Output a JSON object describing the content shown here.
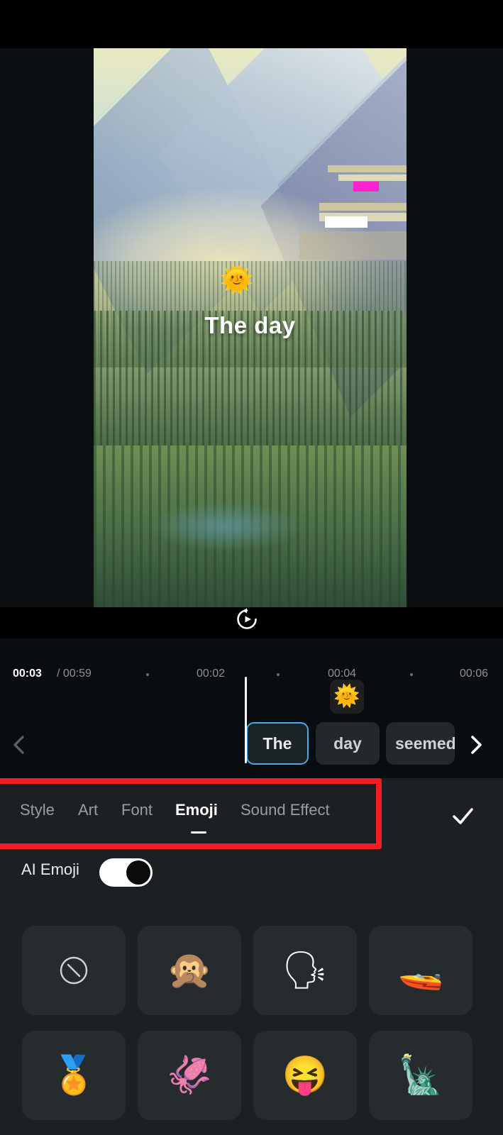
{
  "preview": {
    "caption_text": "The day",
    "sticker_emoji": "🌞",
    "replay_icon": "replay-icon"
  },
  "timeline": {
    "current_time": "00:03",
    "total_time_separator": "/ 00:59",
    "total_time": "00:59",
    "tick_labels": [
      "00:02",
      "00:04",
      "00:06"
    ],
    "sticker_chip_emoji": "🌞",
    "nav_prev_icon": "chevron-left-icon",
    "nav_next_icon": "chevron-right-icon",
    "words": [
      {
        "text": "The",
        "selected": true
      },
      {
        "text": "day",
        "selected": false
      },
      {
        "text": "seemed",
        "selected": false
      }
    ]
  },
  "panel": {
    "tabs": [
      {
        "label": "Style",
        "active": false
      },
      {
        "label": "Art",
        "active": false
      },
      {
        "label": "Font",
        "active": false
      },
      {
        "label": "Emoji",
        "active": true
      },
      {
        "label": "Sound Effect",
        "active": false
      }
    ],
    "confirm_icon": "check-icon",
    "ai_emoji_label": "AI Emoji",
    "ai_emoji_enabled": true,
    "highlight_color": "#f41c24",
    "accent_color": "#4aa7e8",
    "emoji_items": [
      {
        "name": "no-emoji",
        "glyph": ""
      },
      {
        "name": "speak-no-evil-monkey",
        "glyph": "🙊"
      },
      {
        "name": "bust-in-silhouette",
        "glyph": "🗣"
      },
      {
        "name": "speedboat",
        "glyph": "🚤"
      },
      {
        "name": "sports-medal",
        "glyph": "🏅"
      },
      {
        "name": "squid",
        "glyph": "🦑"
      },
      {
        "name": "squinting-face-with-tongue",
        "glyph": "😝"
      },
      {
        "name": "statue-of-liberty",
        "glyph": "🗽"
      }
    ]
  }
}
